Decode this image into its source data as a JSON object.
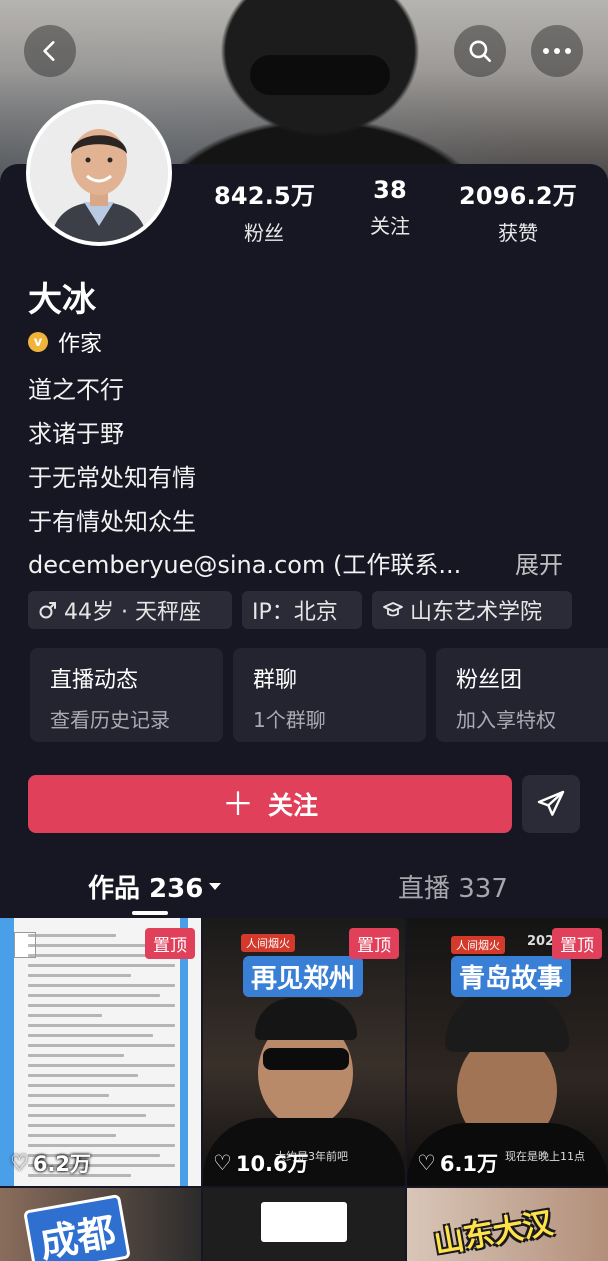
{
  "header": {
    "back_icon": "chevron-left-icon",
    "search_icon": "search-icon",
    "more_icon": "more-dots-icon"
  },
  "profile": {
    "name": "大冰",
    "verification": "作家",
    "bio": [
      "道之不行",
      "求诸于野",
      "于无常处知有情",
      "于有情处知众生"
    ],
    "email": "decemberyue@sina.com (工作联系...",
    "expand": "展开",
    "tags": {
      "age": "44岁 · 天秤座",
      "ip": "IP：北京",
      "school": "山东艺术学院"
    }
  },
  "stats": [
    {
      "value": "842.5万",
      "label": "粉丝"
    },
    {
      "value": "38",
      "label": "关注"
    },
    {
      "value": "2096.2万",
      "label": "获赞"
    }
  ],
  "tiles": [
    {
      "title": "直播动态",
      "subtitle": "查看历史记录"
    },
    {
      "title": "群聊",
      "subtitle": "1个群聊"
    },
    {
      "title": "粉丝团",
      "subtitle": "加入享特权"
    }
  ],
  "actions": {
    "follow_plus": "＋",
    "follow_label": "关注",
    "share_icon": "paper-plane-icon"
  },
  "tabs": {
    "works": "作品 236",
    "live": "直播 337"
  },
  "videos": [
    {
      "pinned": "置顶",
      "likes": "6.2万",
      "banner": ""
    },
    {
      "pinned": "置顶",
      "likes": "10.6万",
      "banner": "再见郑州",
      "tag": "人间烟火",
      "sub": "大约是3年前吧"
    },
    {
      "pinned": "置顶",
      "likes": "6.1万",
      "banner": "青岛故事",
      "tag": "人间烟火",
      "sub": "现在是晚上11点",
      "corner": "202"
    },
    {
      "banner": "成都"
    },
    {
      "banner": ""
    },
    {
      "banner": "山东大汉"
    }
  ],
  "colors": {
    "background": "#161722",
    "accent": "#e1405b",
    "verify_badge": "#f0b43a",
    "banner_blue": "#3a7fd6"
  }
}
